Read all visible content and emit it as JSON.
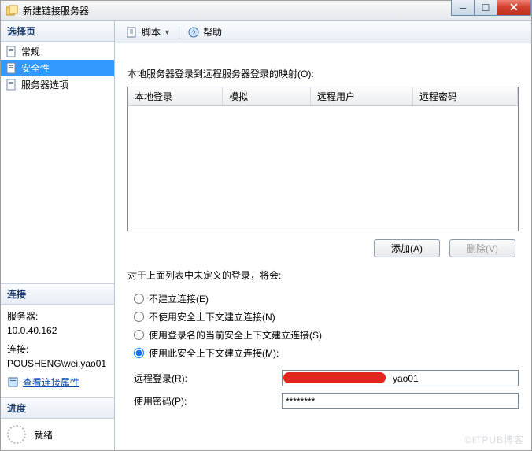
{
  "window": {
    "title": "新建链接服务器"
  },
  "left": {
    "select_page": "选择页",
    "nav": {
      "general": "常规",
      "security": "安全性",
      "server_options": "服务器选项"
    },
    "connection": {
      "header": "连接",
      "server_label": "服务器:",
      "server_value": "10.0.40.162",
      "conn_label": "连接:",
      "conn_value": "POUSHENG\\wei.yao01",
      "view_props": "查看连接属性"
    },
    "progress": {
      "header": "进度",
      "status": "就绪"
    }
  },
  "toolbar": {
    "script": "脚本",
    "help": "帮助"
  },
  "main": {
    "mapping_label": "本地服务器登录到远程服务器登录的映射(O):",
    "cols": {
      "local": "本地登录",
      "impersonate": "模拟",
      "remote_user": "远程用户",
      "remote_pwd": "远程密码"
    },
    "add_btn": "添加(A)",
    "remove_btn": "删除(V)",
    "undefined_label": "对于上面列表中未定义的登录，将会:",
    "r1": "不建立连接(E)",
    "r2": "不使用安全上下文建立连接(N)",
    "r3": "使用登录名的当前安全上下文建立连接(S)",
    "r4": "使用此安全上下文建立连接(M):",
    "remote_login_label": "远程登录(R):",
    "remote_login_value": "yao01",
    "password_label": "使用密码(P):",
    "password_value": "********"
  },
  "watermark": "©ITPUB博客"
}
